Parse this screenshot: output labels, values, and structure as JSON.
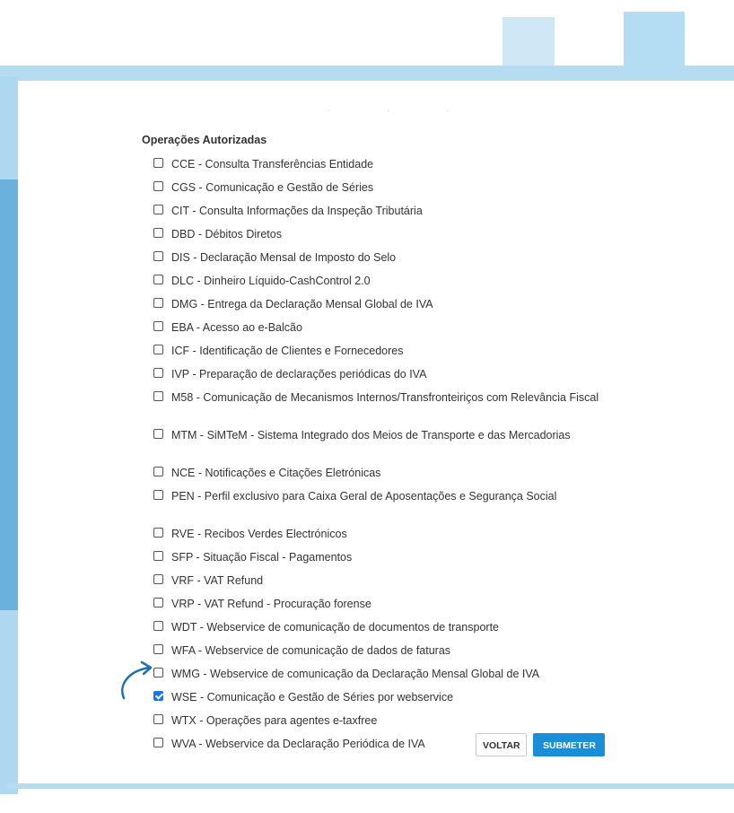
{
  "section": {
    "title": "Operações Autorizadas"
  },
  "operations": [
    {
      "label": "CCE - Consulta Transferências Entidade",
      "checked": false
    },
    {
      "label": "CGS - Comunicação e Gestão de Séries",
      "checked": false
    },
    {
      "label": "CIT - Consulta Informações da Inspeção Tributária",
      "checked": false
    },
    {
      "label": "DBD - Débitos Diretos",
      "checked": false
    },
    {
      "label": "DIS - Declaração Mensal de Imposto do Selo",
      "checked": false
    },
    {
      "label": "DLC - Dinheiro Líquido-CashControl 2.0",
      "checked": false
    },
    {
      "label": "DMG - Entrega da Declaração Mensal Global de IVA",
      "checked": false
    },
    {
      "label": "EBA - Acesso ao e-Balcão",
      "checked": false
    },
    {
      "label": "ICF - Identificação de Clientes e Fornecedores",
      "checked": false
    },
    {
      "label": "IVP - Preparação de declarações periódicas do IVA",
      "checked": false
    },
    {
      "label": "M58 - Comunicação de Mecanismos Internos/Transfronteiriços com Relevância Fiscal",
      "checked": false
    },
    {
      "label": "MTM - SiMTeM - Sistema Integrado dos Meios de Transporte e das Mercadorias",
      "checked": false
    },
    {
      "label": "NCE - Notificações e Citações Eletrónicas",
      "checked": false
    },
    {
      "label": "PEN - Perfil exclusivo para Caixa Geral de Aposentações e Segurança Social",
      "checked": false
    },
    {
      "label": "RVE - Recibos Verdes Electrónicos",
      "checked": false
    },
    {
      "label": "SFP - Situação Fiscal - Pagamentos",
      "checked": false
    },
    {
      "label": "VRF - VAT Refund",
      "checked": false
    },
    {
      "label": "VRP - VAT Refund - Procuração forense",
      "checked": false
    },
    {
      "label": "WDT - Webservice de comunicação de documentos de transporte",
      "checked": false
    },
    {
      "label": "WFA - Webservice de comunicação de dados de faturas",
      "checked": false
    },
    {
      "label": "WMG - Webservice de comunicação da Declaração Mensal Global de IVA",
      "checked": false
    },
    {
      "label": "WSE - Comunicação e Gestão de Séries por webservice",
      "checked": true
    },
    {
      "label": "WTX - Operações para agentes e-taxfree",
      "checked": false
    },
    {
      "label": "WVA - Webservice da Declaração Periódica de IVA",
      "checked": false
    }
  ],
  "buttons": {
    "back_label": "VOLTAR",
    "submit_label": "SUBMETER"
  },
  "colors": {
    "accent": "#1a8fd8",
    "checkbox_checked": "#1a73e8",
    "annotation_arrow": "#1f6fb5",
    "decor_light": "#b6dcf1",
    "decor_dark": "#6ab2dd"
  },
  "icons": {
    "checkbox": "checkbox-icon",
    "annotation": "curved-arrow-icon"
  }
}
